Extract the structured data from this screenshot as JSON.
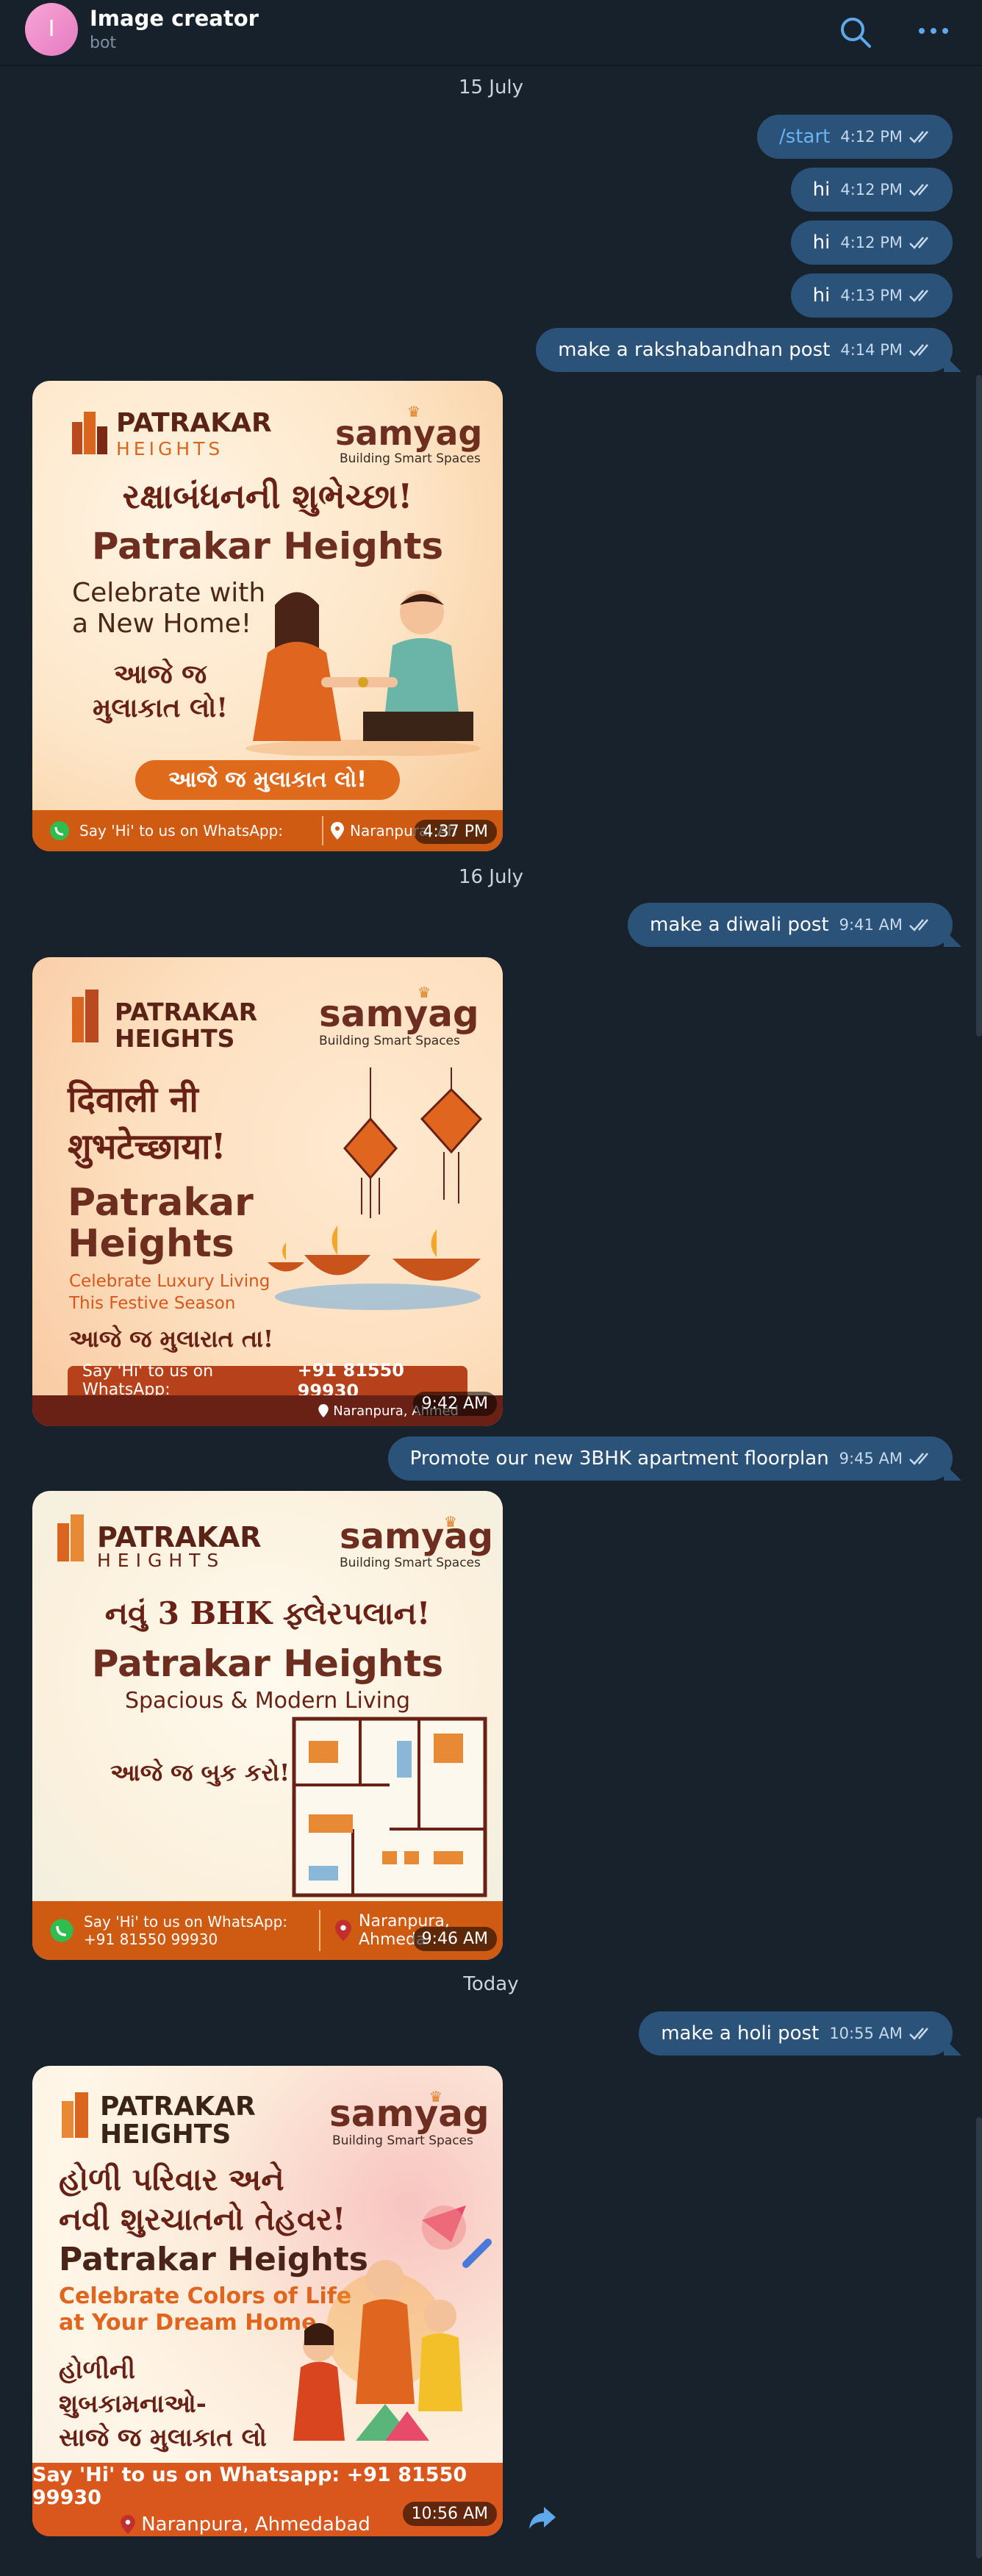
{
  "header": {
    "avatar_letter": "I",
    "title": "Image creator",
    "subtitle": "bot"
  },
  "dates": [
    "15 July",
    "16 July",
    "Today"
  ],
  "messages": {
    "m1": {
      "text": "/start",
      "time": "4:12 PM"
    },
    "m2": {
      "text": "hi",
      "time": "4:12 PM"
    },
    "m3": {
      "text": "hi",
      "time": "4:12 PM"
    },
    "m4": {
      "text": "hi",
      "time": "4:13 PM"
    },
    "m5": {
      "text": "make a rakshabandhan post",
      "time": "4:14 PM"
    },
    "m6": {
      "text": "make a diwali post",
      "time": "9:41 AM"
    },
    "m7": {
      "text": "Promote our new 3BHK apartment floorplan",
      "time": "9:45 AM"
    },
    "m8": {
      "text": "make a holi post",
      "time": "10:55 AM"
    }
  },
  "posts": {
    "p1": {
      "brand_top": "PATRAKAR",
      "brand_bottom": "HEIGHTS",
      "samyag": "samyag",
      "samyag_sub": "Building Smart Spaces",
      "headline": "રક્ષાબંધનની શુભેચ્છા!",
      "title": "Patrakar Heights",
      "tagline_1": "Celebrate with",
      "tagline_2": "a New Home!",
      "gujarati_1": "આજે જ",
      "gujarati_2": "મુલાકાત લો!",
      "cta": "આજે જ મુલાકાત લો!",
      "footer_whatsapp": "Say 'Hi' to us on WhatsApp:",
      "footer_location": "Naranpura, Ah",
      "time": "4:37 PM"
    },
    "p2": {
      "brand_top": "PATRAKAR",
      "brand_bottom": "HEIGHTS",
      "samyag": "samyag",
      "samyag_sub": "Building Smart Spaces",
      "headline_1": "दिवाली नी",
      "headline_2": "शुभटेच्छाया!",
      "title_1": "Patrakar",
      "title_2": "Heights",
      "tagline_1": "Celebrate Luxury Living",
      "tagline_2": "This Festive Season",
      "gujarati": "આજે જ મુલારાત તા!",
      "footer_whatsapp": "Say 'Hi' to us on WhatsApp:",
      "footer_phone": "+91 81550 99930",
      "footer_location": "Naranpura, Ahmed",
      "time": "9:42 AM"
    },
    "p3": {
      "brand_top": "PATRAKAR",
      "brand_bottom": "HEIGHTS",
      "samyag": "samyag",
      "samyag_sub": "Building Smart Spaces",
      "headline": "નવું 3 BHK ફ્લેરપલાન!",
      "title": "Patrakar Heights",
      "tagline": "Spacious & Modern Living",
      "gujarati": "આજે જ બુક કરો!",
      "footer_whatsapp_1": "Say 'Hi' to us on WhatsApp:",
      "footer_whatsapp_2": "+91 81550 99930",
      "footer_location_1": "Naranpura,",
      "footer_location_2": "Ahmeda",
      "time": "9:46 AM"
    },
    "p4": {
      "brand_top": "PATRAKAR",
      "brand_bottom": "HEIGHTS",
      "samyag": "samyag",
      "samyag_sub": "Building Smart Spaces",
      "headline_1": "હોળી પરિવાર અને",
      "headline_2": "નવી શુરચાતનો તેહવર!",
      "title": "Patrakar Heights",
      "tagline_1": "Celebrate Colors of Life",
      "tagline_2": "at Your Dream Home",
      "gujarati_1": "હોળીની",
      "gujarati_2": "શુબકામનાઓ-",
      "gujarati_3": "સાજે જ મુલાકાત લો",
      "footer_whatsapp": "Say 'Hi' to us on Whatsapp: +91 81550 99930",
      "footer_location": "Naranpura, Ahmedabad",
      "time": "10:56 AM"
    }
  },
  "colors": {
    "background": "#18222d",
    "bubble_out": "#2b5278",
    "accent": "#6ab3f3",
    "poster_orange": "#cf5a12",
    "poster_brown": "#6e2e1f"
  }
}
